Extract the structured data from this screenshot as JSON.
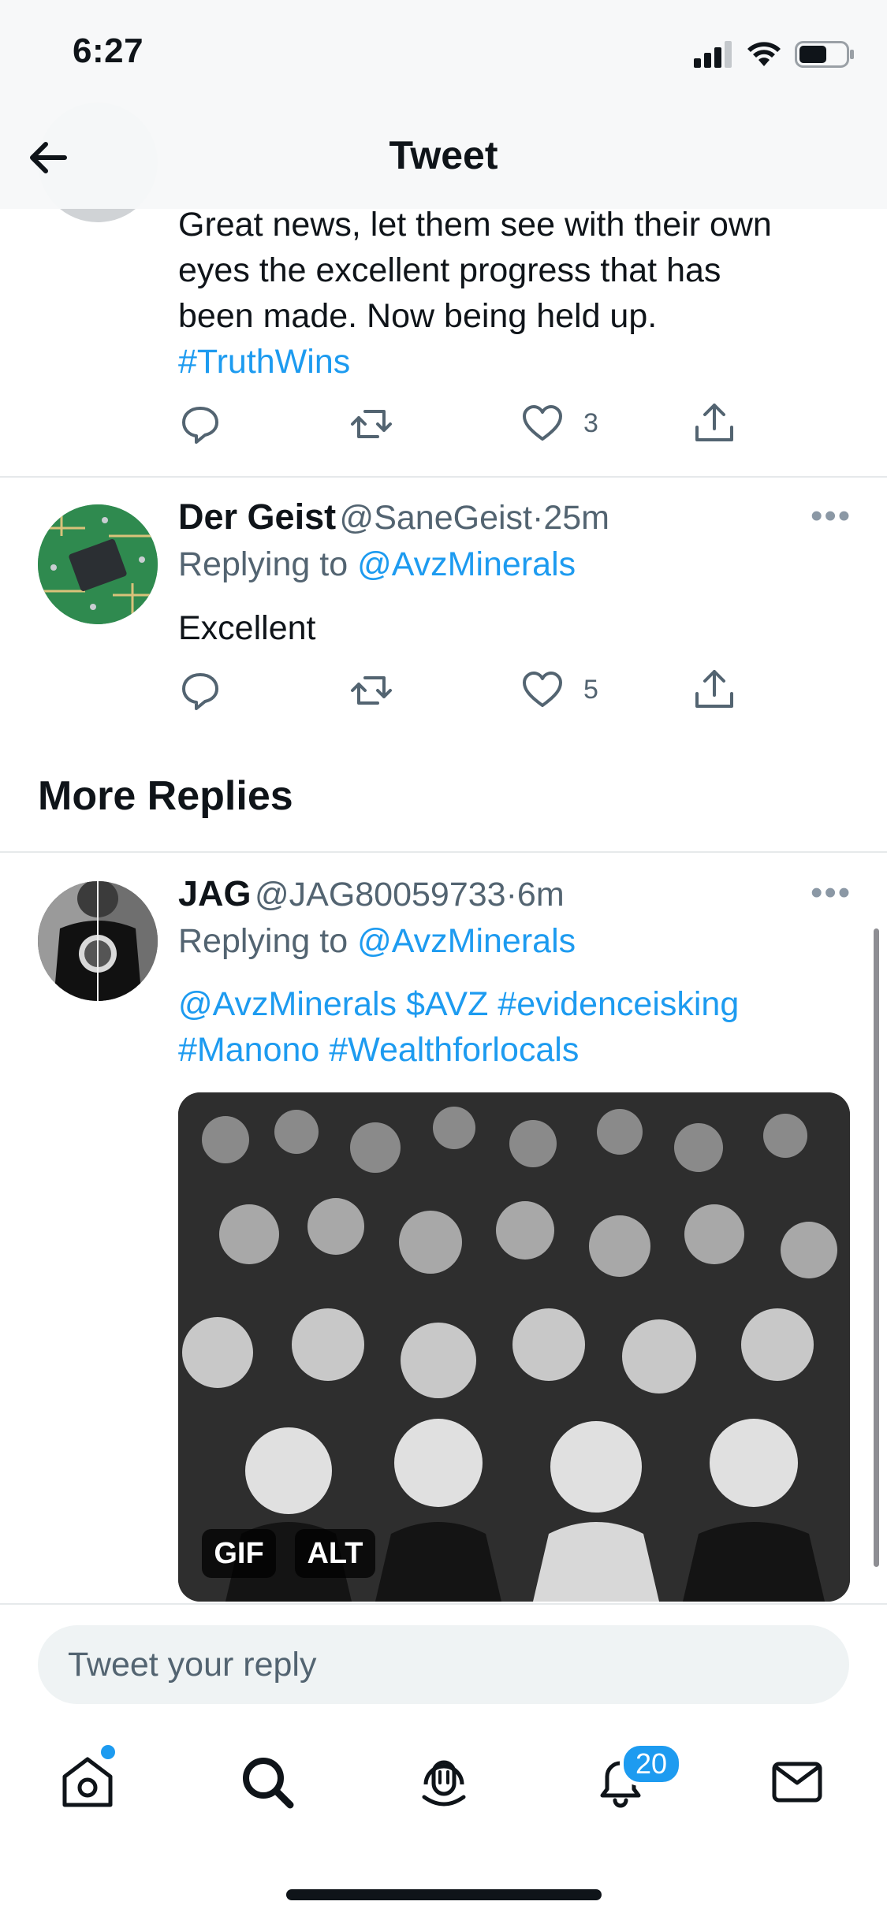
{
  "status_bar": {
    "time": "6:27"
  },
  "header": {
    "title": "Tweet",
    "back_icon": "arrow-left-icon"
  },
  "top_tweet": {
    "text_line1": "Great news, let them see with their own",
    "text_line2": "eyes the excellent progress that has",
    "text_line3": "been made. Now being held up.",
    "hashtag": "#TruthWins",
    "like_count": "3"
  },
  "reply_1": {
    "name": "Der Geist",
    "handle": "@SaneGeist",
    "dot": "·",
    "time": "25m",
    "replying_prefix": "Replying to",
    "replying_handle": "@AvzMinerals",
    "text": "Excellent",
    "like_count": "5"
  },
  "section": {
    "more_replies": "More Replies"
  },
  "reply_2": {
    "name": "JAG",
    "handle": "@JAG80059733",
    "dot": "·",
    "time": "6m",
    "replying_prefix": "Replying to",
    "replying_handle": "@AvzMinerals",
    "text_line1": "@AvzMinerals $AVZ #evidenceisking",
    "text_line2": "#Manono #Wealthforlocals",
    "gif_badge": "GIF",
    "alt_badge": "ALT"
  },
  "reply_box": {
    "placeholder": "Tweet your reply"
  },
  "tab_bar": {
    "notifications_badge": "20",
    "icons": [
      "home-icon",
      "search-icon",
      "spaces-icon",
      "notifications-icon",
      "messages-icon"
    ]
  },
  "colors": {
    "accent": "#1d9bf0",
    "text": "#0f1419",
    "muted": "#536471"
  }
}
